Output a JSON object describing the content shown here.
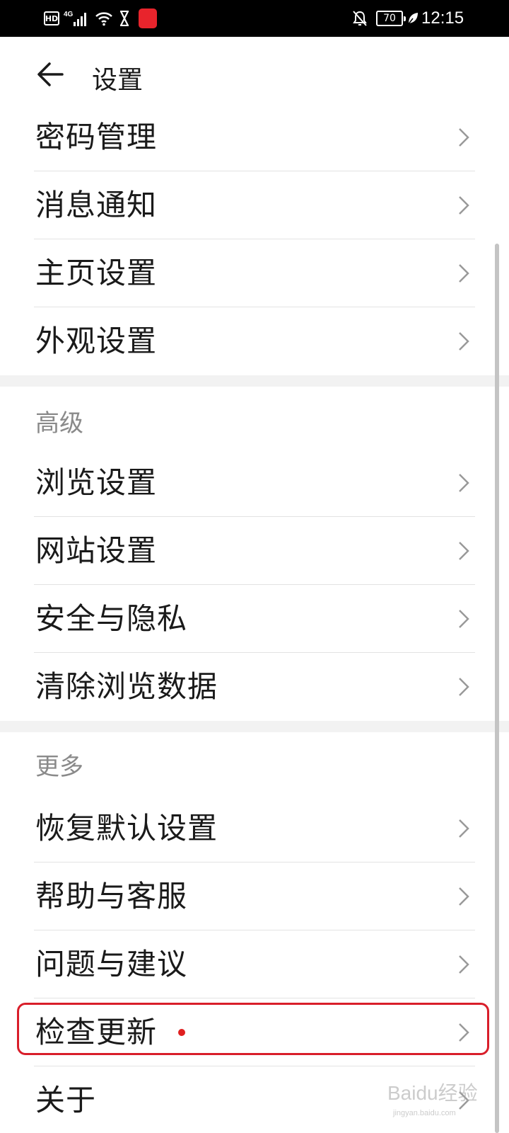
{
  "status_bar": {
    "hd": "HD",
    "network": "4G",
    "battery": "70",
    "time": "12:15"
  },
  "header": {
    "title": "设置"
  },
  "groups": {
    "general": [
      "密码管理",
      "消息通知",
      "主页设置",
      "外观设置"
    ],
    "advanced_title": "高级",
    "advanced": [
      "浏览设置",
      "网站设置",
      "安全与隐私",
      "清除浏览数据"
    ],
    "more_title": "更多",
    "more": [
      "恢复默认设置",
      "帮助与客服",
      "问题与建议",
      "检查更新",
      "关于"
    ]
  },
  "watermark": {
    "text": "Baidu经验",
    "sub": "jingyan.baidu.com"
  },
  "colors": {
    "accent_red": "#d91e2a",
    "dot_red": "#e02020",
    "divider": "#e3e3e3"
  }
}
